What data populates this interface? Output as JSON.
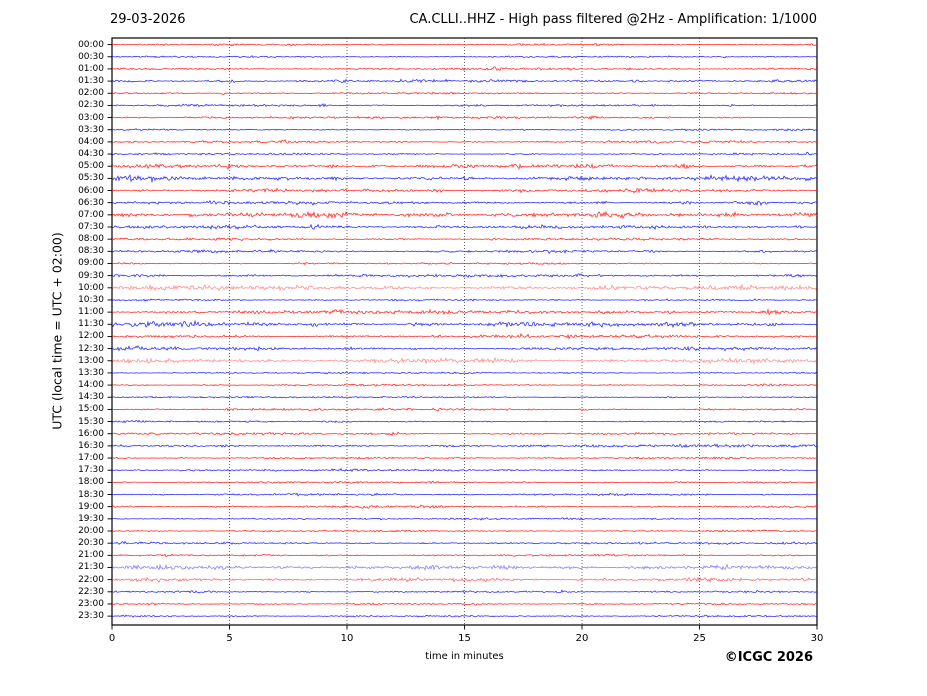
{
  "header": {
    "date": "29-03-2026",
    "title": "CA.CLLI..HHZ - High pass filtered @2Hz - Amplification: 1/1000"
  },
  "axes": {
    "y_label": "UTC (local time = UTC + 02:00)",
    "x_label": "time in minutes",
    "x_ticks": [
      0,
      5,
      10,
      15,
      20,
      25,
      30
    ],
    "grid_minutes": [
      5,
      10,
      15,
      20,
      25
    ]
  },
  "footer": {
    "copyright": "©ICGC 2026"
  },
  "colors": {
    "red_trace": "#ff0000",
    "blue_trace": "#0000ff",
    "grid": "#444444",
    "frame": "#000000",
    "background": "#ffffff"
  },
  "chart_data": {
    "type": "line",
    "title": "CA.CLLI..HHZ - High pass filtered @2Hz - Amplification: 1/1000",
    "subtitle": "Helicorder daily plot, 48 half-hour traces, alternating red (:00) and blue (:30)",
    "xlabel": "time in minutes",
    "ylabel": "UTC (local time = UTC + 02:00)",
    "xlim": [
      0,
      30
    ],
    "row_interval_minutes": 30,
    "grid": "vertical dotted lines every 5 minutes",
    "legend_position": "none",
    "rows": [
      {
        "time": "00:00",
        "color": "red",
        "noise": 0.5,
        "events": []
      },
      {
        "time": "00:30",
        "color": "blue",
        "noise": 0.45,
        "events": [
          [
            26.0,
            3.2,
            0.08
          ]
        ]
      },
      {
        "time": "01:00",
        "color": "red",
        "noise": 0.55,
        "events": [
          [
            16.3,
            1.2,
            0.3
          ],
          [
            19.5,
            1.4,
            0.2
          ],
          [
            22.0,
            1.2,
            0.2
          ]
        ]
      },
      {
        "time": "01:30",
        "color": "blue",
        "noise": 0.75,
        "events": [
          [
            5.0,
            1.2,
            0.5
          ],
          [
            9.8,
            1.4,
            0.4
          ],
          [
            16.2,
            1.3,
            0.4
          ],
          [
            22.3,
            1.2,
            0.3
          ]
        ]
      },
      {
        "time": "02:00",
        "color": "red",
        "noise": 0.5,
        "events": [
          [
            4.8,
            2.2,
            0.12
          ]
        ]
      },
      {
        "time": "02:30",
        "color": "blue",
        "noise": 0.55,
        "events": [
          [
            9.0,
            1.4,
            0.3
          ],
          [
            26.3,
            1.5,
            0.2
          ]
        ]
      },
      {
        "time": "03:00",
        "color": "red",
        "noise": 0.6,
        "events": [
          [
            20.5,
            1.1,
            0.3
          ]
        ]
      },
      {
        "time": "03:30",
        "color": "blue",
        "noise": 0.45,
        "events": []
      },
      {
        "time": "04:00",
        "color": "red",
        "noise": 0.6,
        "events": [
          [
            7.3,
            1.5,
            0.25
          ],
          [
            21.0,
            1.4,
            0.3
          ]
        ]
      },
      {
        "time": "04:30",
        "color": "blue",
        "noise": 0.5,
        "events": [
          [
            29.6,
            1.6,
            0.2
          ]
        ]
      },
      {
        "time": "05:00",
        "color": "red",
        "noise": 1.0,
        "events": [
          [
            5.1,
            1.7,
            0.3
          ],
          [
            9.4,
            1.7,
            0.3
          ],
          [
            20.2,
            1.9,
            0.5
          ],
          [
            24.4,
            2.1,
            0.3
          ]
        ]
      },
      {
        "time": "05:30",
        "color": "blue",
        "noise": 1.15,
        "events": [
          [
            1.5,
            1.9,
            0.8
          ],
          [
            5.3,
            1.7,
            0.3
          ],
          [
            9.6,
            2.1,
            0.3
          ],
          [
            15.0,
            1.7,
            0.3
          ],
          [
            27.3,
            2.1,
            0.6
          ]
        ]
      },
      {
        "time": "06:00",
        "color": "red",
        "noise": 0.9,
        "events": [
          [
            13.8,
            1.7,
            0.3
          ],
          [
            17.5,
            1.6,
            0.3
          ],
          [
            23.3,
            1.7,
            0.3
          ]
        ]
      },
      {
        "time": "06:30",
        "color": "blue",
        "noise": 0.8,
        "events": [
          [
            20.9,
            1.5,
            0.3
          ],
          [
            24.4,
            1.6,
            0.3
          ],
          [
            27.5,
            1.7,
            0.7
          ]
        ]
      },
      {
        "time": "07:00",
        "color": "red",
        "noise": 1.35,
        "events": [
          [
            3.5,
            1.7,
            0.3
          ],
          [
            8.2,
            1.9,
            0.4
          ],
          [
            14.2,
            2.1,
            0.4
          ],
          [
            24.0,
            1.7,
            0.3
          ],
          [
            26.5,
            1.7,
            0.3
          ]
        ]
      },
      {
        "time": "07:30",
        "color": "blue",
        "noise": 0.9,
        "events": [
          [
            5.1,
            1.6,
            0.3
          ],
          [
            8.6,
            1.7,
            0.3
          ],
          [
            14.1,
            1.9,
            0.3
          ],
          [
            25.2,
            1.6,
            0.3
          ],
          [
            29.2,
            1.7,
            0.2
          ]
        ]
      },
      {
        "time": "08:00",
        "color": "red",
        "noise": 0.6,
        "events": [
          [
            5.6,
            2.5,
            0.12
          ],
          [
            16.2,
            1.5,
            0.25
          ]
        ]
      },
      {
        "time": "08:30",
        "color": "blue",
        "noise": 0.7,
        "events": [
          [
            6.8,
            1.5,
            0.3
          ],
          [
            18.8,
            1.4,
            0.3
          ],
          [
            27.8,
            1.5,
            0.3
          ]
        ]
      },
      {
        "time": "09:00",
        "color": "red",
        "noise": 0.5,
        "events": [
          [
            8.1,
            1.3,
            0.3
          ]
        ]
      },
      {
        "time": "09:30",
        "color": "blue",
        "noise": 0.8,
        "events": [
          [
            6.0,
            1.3,
            0.4
          ],
          [
            13.0,
            1.3,
            0.4
          ],
          [
            20.0,
            1.3,
            0.4
          ]
        ]
      },
      {
        "time": "10:00",
        "color": "red",
        "noise": 1.25,
        "alpha": 0.45,
        "events": []
      },
      {
        "time": "10:30",
        "color": "blue",
        "noise": 0.5,
        "events": []
      },
      {
        "time": "11:00",
        "color": "red",
        "noise": 1.0,
        "events": [
          [
            9.6,
            1.9,
            0.3
          ],
          [
            12.0,
            1.7,
            0.3
          ],
          [
            20.9,
            1.9,
            0.3
          ],
          [
            23.7,
            1.7,
            0.3
          ],
          [
            28.2,
            2.4,
            0.8
          ]
        ]
      },
      {
        "time": "11:30",
        "color": "blue",
        "noise": 1.15,
        "events": [
          [
            1.5,
            2.1,
            0.6
          ],
          [
            3.5,
            2.1,
            0.5
          ],
          [
            8.6,
            1.7,
            0.3
          ],
          [
            12.8,
            1.7,
            0.3
          ],
          [
            23.5,
            1.7,
            0.3
          ],
          [
            28.1,
            1.7,
            0.3
          ]
        ]
      },
      {
        "time": "12:00",
        "color": "red",
        "noise": 0.8,
        "events": [
          [
            13.8,
            1.7,
            0.25
          ],
          [
            17.4,
            1.7,
            0.25
          ],
          [
            19.4,
            1.7,
            0.25
          ]
        ]
      },
      {
        "time": "12:30",
        "color": "blue",
        "noise": 0.9,
        "events": [
          [
            1.0,
            1.7,
            0.3
          ],
          [
            2.6,
            1.5,
            0.3
          ],
          [
            6.4,
            1.5,
            0.3
          ],
          [
            10.1,
            1.5,
            0.3
          ],
          [
            21.0,
            1.5,
            0.3
          ]
        ]
      },
      {
        "time": "13:00",
        "color": "red",
        "noise": 1.25,
        "alpha": 0.45,
        "events": []
      },
      {
        "time": "13:30",
        "color": "blue",
        "noise": 0.45,
        "events": []
      },
      {
        "time": "14:00",
        "color": "red",
        "noise": 0.5,
        "events": []
      },
      {
        "time": "14:30",
        "color": "blue",
        "noise": 0.45,
        "events": []
      },
      {
        "time": "15:00",
        "color": "red",
        "noise": 0.6,
        "events": [
          [
            5.0,
            1.6,
            0.25
          ],
          [
            13.8,
            1.5,
            0.25
          ],
          [
            20.1,
            1.4,
            0.25
          ]
        ]
      },
      {
        "time": "15:30",
        "color": "blue",
        "noise": 0.5,
        "events": []
      },
      {
        "time": "16:00",
        "color": "red",
        "noise": 0.6,
        "events": [
          [
            12.0,
            1.1,
            0.3
          ]
        ]
      },
      {
        "time": "16:30",
        "color": "blue",
        "noise": 0.8,
        "events": []
      },
      {
        "time": "17:00",
        "color": "red",
        "noise": 0.5,
        "events": []
      },
      {
        "time": "17:30",
        "color": "blue",
        "noise": 0.55,
        "events": [
          [
            9.6,
            1.5,
            0.25
          ]
        ]
      },
      {
        "time": "18:00",
        "color": "red",
        "noise": 0.5,
        "events": []
      },
      {
        "time": "18:30",
        "color": "blue",
        "noise": 0.6,
        "events": [
          [
            5.3,
            1.9,
            0.15
          ]
        ]
      },
      {
        "time": "19:00",
        "color": "red",
        "noise": 0.6,
        "events": [
          [
            10.8,
            2.6,
            0.25
          ]
        ]
      },
      {
        "time": "19:30",
        "color": "blue",
        "noise": 0.45,
        "events": []
      },
      {
        "time": "20:00",
        "color": "red",
        "noise": 0.5,
        "events": []
      },
      {
        "time": "20:30",
        "color": "blue",
        "noise": 0.55,
        "events": [
          [
            0.4,
            1.5,
            0.2
          ]
        ]
      },
      {
        "time": "21:00",
        "color": "red",
        "noise": 0.5,
        "events": []
      },
      {
        "time": "21:30",
        "color": "blue",
        "noise": 1.1,
        "alpha": 0.5,
        "events": []
      },
      {
        "time": "22:00",
        "color": "red",
        "noise": 0.95,
        "alpha": 0.6,
        "events": []
      },
      {
        "time": "22:30",
        "color": "blue",
        "noise": 0.55,
        "events": [
          [
            19.1,
            1.7,
            0.25
          ]
        ]
      },
      {
        "time": "23:00",
        "color": "red",
        "noise": 0.5,
        "events": [
          [
            15.4,
            1.4,
            0.12
          ]
        ]
      },
      {
        "time": "23:30",
        "color": "blue",
        "noise": 0.45,
        "events": []
      }
    ]
  }
}
